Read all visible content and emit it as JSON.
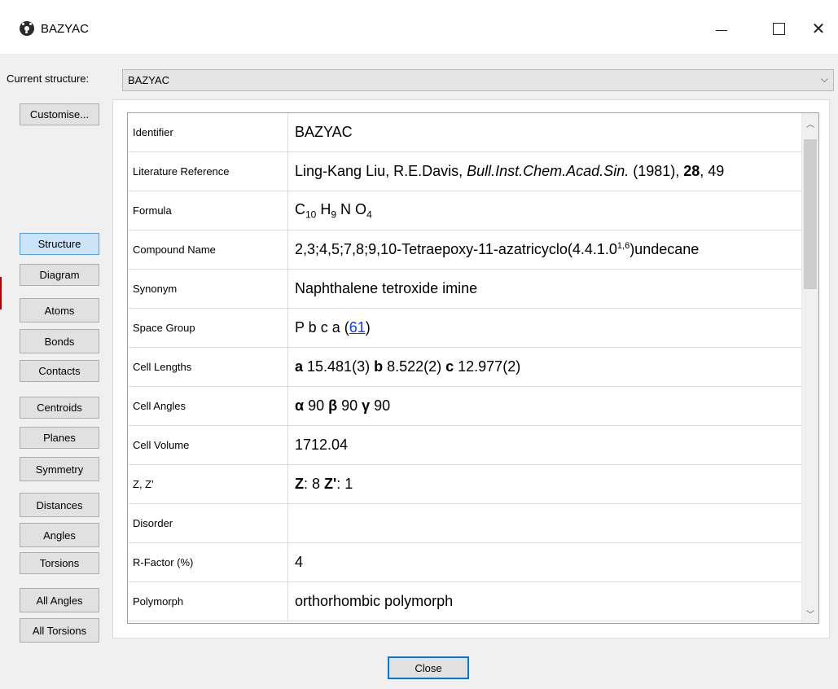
{
  "window": {
    "title": "BAZYAC",
    "icon": "molecule-icon",
    "minimize": "—",
    "maximize": "☐",
    "close": "✕"
  },
  "current_structure": {
    "label": "Current structure:",
    "value": "BAZYAC"
  },
  "sidebar": {
    "customise": "Customise...",
    "buttons": {
      "structure": "Structure",
      "diagram": "Diagram",
      "atoms": "Atoms",
      "bonds": "Bonds",
      "contacts": "Contacts",
      "centroids": "Centroids",
      "planes": "Planes",
      "symmetry": "Symmetry",
      "distances": "Distances",
      "angles": "Angles",
      "torsions": "Torsions",
      "all_angles": "All Angles",
      "all_torsions": "All Torsions"
    },
    "active": "Structure"
  },
  "table": {
    "identifier": {
      "label": "Identifier",
      "value": "BAZYAC"
    },
    "literature": {
      "label": "Literature Reference",
      "authors": "Ling-Kang Liu, R.E.Davis, ",
      "journal": "Bull.Inst.Chem.Acad.Sin.",
      "year": " (1981), ",
      "volume": "28",
      "page": ", 49"
    },
    "formula": {
      "label": "Formula",
      "c": "C",
      "c_n": "10",
      "h": " H",
      "h_n": "9",
      "n": " N",
      "o": " O",
      "o_n": "4"
    },
    "compound": {
      "label": "Compound Name",
      "pre": "2,3;4,5;7,8;9,10-Tetraepoxy-11-azatricyclo(4.4.1.0",
      "sup": "1,6",
      "post": ")undecane"
    },
    "synonym": {
      "label": "Synonym",
      "value": "Naphthalene tetroxide imine"
    },
    "space_group": {
      "label": "Space Group",
      "value": "P b c a (",
      "link": "61",
      "close": ")"
    },
    "cell_lengths": {
      "label": "Cell Lengths",
      "a": "a",
      "a_val": " 15.481(3) ",
      "b": "b",
      "b_val": " 8.522(2) ",
      "c": "c",
      "c_val": " 12.977(2)"
    },
    "cell_angles": {
      "label": "Cell Angles",
      "alpha": "α",
      "alpha_val": " 90 ",
      "beta": "β",
      "beta_val": " 90 ",
      "gamma": "γ",
      "gamma_val": " 90"
    },
    "cell_volume": {
      "label": "Cell Volume",
      "value": "1712.04"
    },
    "z": {
      "label": "Z, Z'",
      "z": "Z",
      "z_val": ": 8 ",
      "zp": "Z'",
      "zp_val": ": 1"
    },
    "disorder": {
      "label": "Disorder",
      "value": ""
    },
    "r_factor": {
      "label": "R-Factor (%)",
      "value": "4"
    },
    "polymorph": {
      "label": "Polymorph",
      "value": "orthorhombic polymorph"
    }
  },
  "close_button": "Close"
}
